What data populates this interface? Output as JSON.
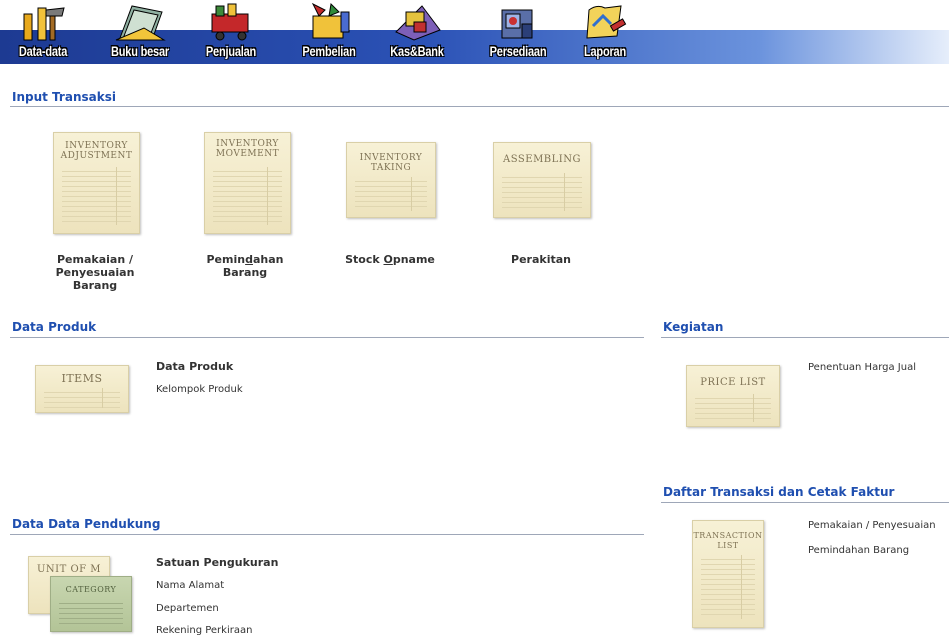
{
  "nav": [
    {
      "label": "Data-data",
      "icon": "tools-icon"
    },
    {
      "label": "Buku besar",
      "icon": "ledger-icon"
    },
    {
      "label": "Penjualan",
      "icon": "cart-icon"
    },
    {
      "label": "Pembelian",
      "icon": "shopping-bag-icon"
    },
    {
      "label": "Kas&Bank",
      "icon": "money-icon"
    },
    {
      "label": "Persediaan",
      "icon": "warehouse-icon"
    },
    {
      "label": "Laporan",
      "icon": "report-icon"
    }
  ],
  "input_transaksi": {
    "title": "Input Transaksi",
    "items": [
      {
        "card": "INVENTORY ADJUSTMENT",
        "caption_pre": "Pemakaian /",
        "caption_mid": "Penyesuaian",
        "caption_end": "Barang"
      },
      {
        "card": "INVENTORY MOVEMENT",
        "caption_a": "Pemin",
        "caption_u": "d",
        "caption_b": "ahan",
        "caption_end": "Barang"
      },
      {
        "card": "INVENTORY TAKING",
        "caption_a": "Stock ",
        "caption_u": "O",
        "caption_b": "pname"
      },
      {
        "card": "ASSEMBLING",
        "caption": "Perakitan"
      }
    ]
  },
  "data_produk": {
    "title": "Data Produk",
    "card": "ITEMS",
    "main": "Data Produk",
    "links": [
      "Kelompok Produk"
    ]
  },
  "kegiatan": {
    "title": "Kegiatan",
    "card": "PRICE LIST",
    "links": [
      "Penentuan Harga Jual"
    ]
  },
  "daftar": {
    "title": "Daftar Transaksi dan Cetak Faktur",
    "card": "TRANSACTION LIST",
    "links": [
      "Pemakaian / Penyesuaian",
      "Pemindahan Barang"
    ]
  },
  "pendukung": {
    "title": "Data Data Pendukung",
    "card_back": "UNIT OF M",
    "card_front": "CATEGORY",
    "main": "Satuan Pengukuran",
    "links": [
      "Nama Alamat",
      "Departemen",
      "Rekening Perkiraan"
    ]
  }
}
